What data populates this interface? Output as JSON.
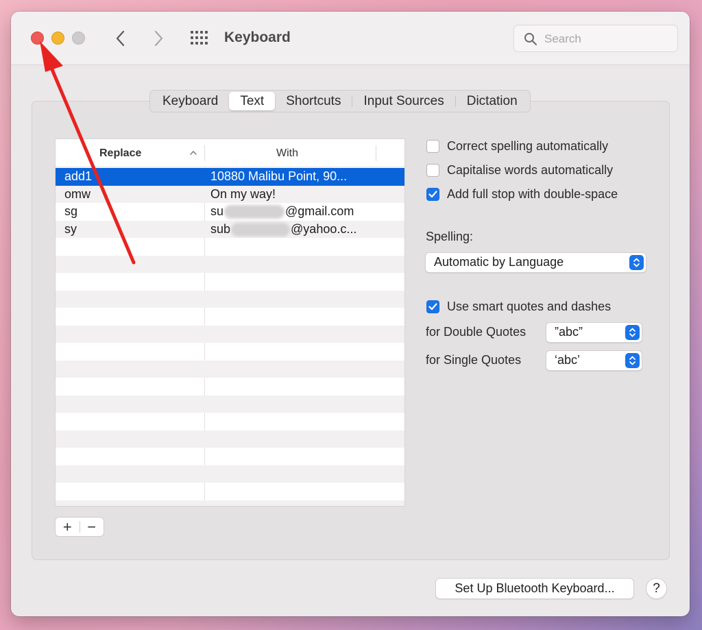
{
  "window": {
    "title": "Keyboard",
    "search_placeholder": "Search"
  },
  "tabs": [
    {
      "label": "Keyboard",
      "active": false
    },
    {
      "label": "Text",
      "active": true
    },
    {
      "label": "Shortcuts",
      "active": false
    },
    {
      "label": "Input Sources",
      "active": false
    },
    {
      "label": "Dictation",
      "active": false
    }
  ],
  "table": {
    "col_replace": "Replace",
    "col_with": "With",
    "rows": [
      {
        "replace": "add1",
        "with": "10880 Malibu Point, 90...",
        "selected": true
      },
      {
        "replace": "omw",
        "with": "On my way!"
      },
      {
        "replace": "sg",
        "with_prefix": "su",
        "with_suffix": "@gmail.com",
        "redacted": true
      },
      {
        "replace": "sy",
        "with_prefix": "sub",
        "with_suffix": "@yahoo.c...",
        "redacted": true
      }
    ]
  },
  "buttons": {
    "add": "+",
    "remove": "−",
    "bluetooth": "Set Up Bluetooth Keyboard...",
    "help": "?"
  },
  "options": {
    "correct_spelling": {
      "label": "Correct spelling automatically",
      "checked": false
    },
    "capitalise": {
      "label": "Capitalise words automatically",
      "checked": false
    },
    "full_stop": {
      "label": "Add full stop with double-space",
      "checked": true
    },
    "spelling_label": "Spelling:",
    "spelling_value": "Automatic by Language",
    "smart_quotes": {
      "label": "Use smart quotes and dashes",
      "checked": true
    },
    "double_quotes_label": "for Double Quotes",
    "double_quotes_value": "”abc”",
    "single_quotes_label": "for Single Quotes",
    "single_quotes_value": "‘abc’"
  },
  "colors": {
    "accent": "#1a73e8",
    "selection": "#0a63d9",
    "annotation_arrow": "#e8231f"
  },
  "icons": [
    "search-icon",
    "back-chevron-icon",
    "forward-chevron-icon",
    "grid-icon",
    "checkmark-icon",
    "stepper-icon",
    "sort-caret-icon"
  ]
}
